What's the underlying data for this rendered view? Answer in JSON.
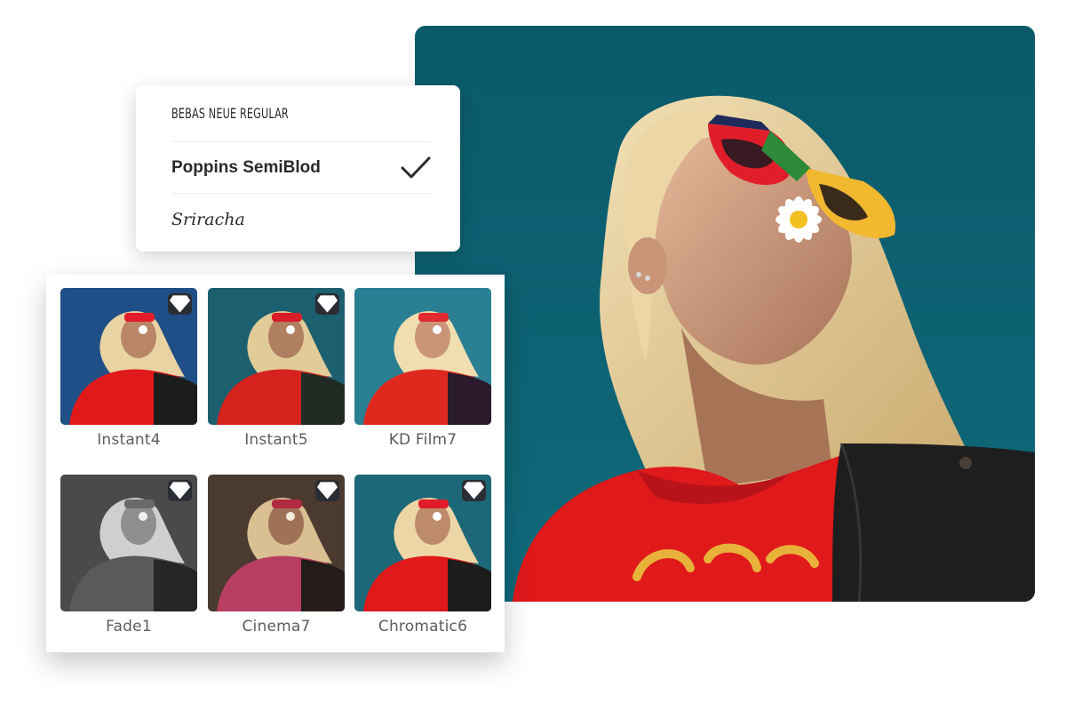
{
  "font_menu": {
    "items": [
      {
        "label": "BEBAS NEUE REGULAR",
        "selected": false
      },
      {
        "label": "Poppins SemiBlod",
        "selected": true
      },
      {
        "label": "Sriracha",
        "selected": false
      }
    ],
    "selected_icon": "checkmark-icon"
  },
  "filters": {
    "premium_icon": "diamond-icon",
    "items": [
      {
        "label": "Instant4",
        "tint": "#1f4f86",
        "premium": true
      },
      {
        "label": "Instant5",
        "tint": "#1c5f6e",
        "premium": true
      },
      {
        "label": "KD Film7",
        "tint": "#2a7f92",
        "premium": false
      },
      {
        "label": "Fade1",
        "tint": "#4a4a4a",
        "premium": true
      },
      {
        "label": "Cinema7",
        "tint": "#4a3a30",
        "premium": true
      },
      {
        "label": "Chromatic6",
        "tint": "#1d6878",
        "premium": true
      }
    ]
  },
  "colors": {
    "sky": "#0d5e6b",
    "shirt": "#e0191b",
    "hair": "#e6cf9f",
    "jacket": "#1e1e1e"
  }
}
